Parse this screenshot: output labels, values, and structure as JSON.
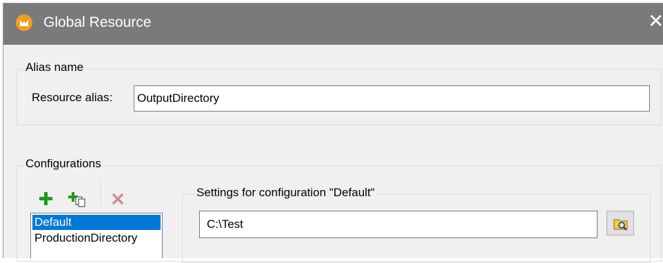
{
  "window": {
    "title": "Global Resource"
  },
  "alias_group": {
    "legend": "Alias name",
    "label": "Resource alias:",
    "value": "OutputDirectory"
  },
  "config_group": {
    "legend": "Configurations",
    "toolbar": {
      "add_icon": "green-plus-icon",
      "copy_icon": "add-copy-icon",
      "delete_icon": "red-x-icon"
    },
    "items": [
      "Default",
      "ProductionDirectory"
    ],
    "selected": "Default"
  },
  "settings_group": {
    "legend": "Settings for configuration \"Default\"",
    "path_value": "C:\\Test",
    "browse_icon": "folder-browse-icon"
  },
  "colors": {
    "selection": "#0078d7",
    "titlebar": "#7a7a7a",
    "add_green": "#1e9b1e",
    "delete_red": "#d48a8a"
  }
}
